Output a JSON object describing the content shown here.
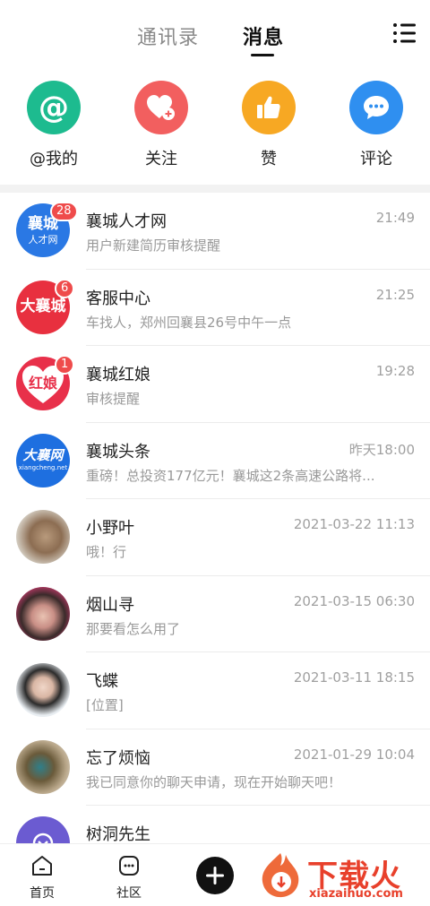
{
  "header": {
    "tab_contacts": "通讯录",
    "tab_messages": "消息",
    "menu_icon": "list-menu-icon"
  },
  "quick_actions": [
    {
      "label": "@我的",
      "icon": "at-icon",
      "color": "#1dbb8f"
    },
    {
      "label": "关注",
      "icon": "heart-plus-icon",
      "color": "#f25f5f"
    },
    {
      "label": "赞",
      "icon": "thumbs-up-icon",
      "color": "#f7a823"
    },
    {
      "label": "评论",
      "icon": "comment-bubble-icon",
      "color": "#2f8ff0"
    }
  ],
  "conversations": [
    {
      "name": "襄城人才网",
      "time": "21:49",
      "preview": "用户新建简历审核提醒",
      "badge": "28",
      "avatar_text_1": "襄城",
      "avatar_text_2": "人才网",
      "avatar_color": "#2a78e4"
    },
    {
      "name": "客服中心",
      "time": "21:25",
      "preview": "车找人，郑州回襄县26号中午一点",
      "badge": "6",
      "avatar_text_1": "大襄城",
      "avatar_color": "#e8303f"
    },
    {
      "name": "襄城红娘",
      "time": "19:28",
      "preview": "审核提醒",
      "badge": "1",
      "avatar_text_1": "红娘",
      "avatar_color": "#e8304a"
    },
    {
      "name": "襄城头条",
      "time": "昨天18:00",
      "preview": "重磅！总投资177亿元！襄城这2条高速公路将...",
      "avatar_text_1": "大襄网",
      "avatar_text_2": "xiangcheng.net",
      "avatar_color": "#1e6fe0"
    },
    {
      "name": "小野叶",
      "time": "2021-03-22 11:13",
      "preview": "哦！行"
    },
    {
      "name": "烟山寻",
      "time": "2021-03-15 06:30",
      "preview": "那要看怎么用了"
    },
    {
      "name": "飞蝶",
      "time": "2021-03-11 18:15",
      "preview": "[位置]"
    },
    {
      "name": "忘了烦恼",
      "time": "2021-01-29 10:04",
      "preview": "我已同意你的聊天申请，现在开始聊天吧！"
    },
    {
      "name": "树洞先生",
      "time": "",
      "preview": ""
    }
  ],
  "bottom_nav": {
    "home": "首页",
    "community": "社区"
  },
  "watermark": {
    "text": "下载火",
    "sub": "xiazaihuo.com"
  }
}
